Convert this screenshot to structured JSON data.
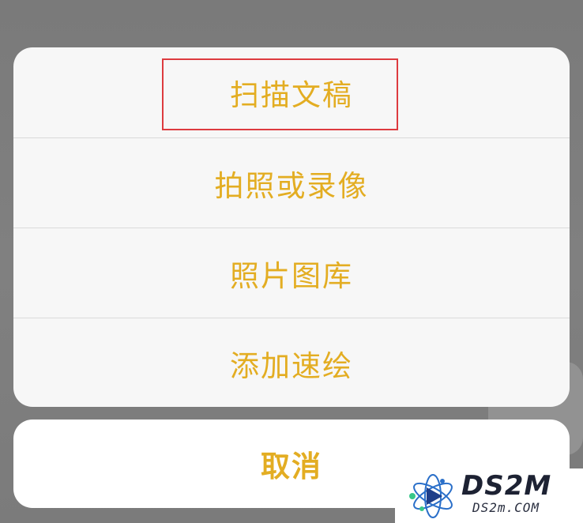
{
  "action_sheet": {
    "items": [
      {
        "label": "扫描文稿",
        "highlighted": true
      },
      {
        "label": "拍照或录像"
      },
      {
        "label": "照片图库"
      },
      {
        "label": "添加速绘"
      }
    ],
    "cancel_label": "取消"
  },
  "watermark": {
    "brand": "DS2M",
    "url": "DS2m.COM"
  },
  "colors": {
    "accent_text": "#e3ad22",
    "highlight_border": "#dd3b3f",
    "sheet_background": "#f7f7f7",
    "dimmed_backdrop": "#7d7d7d"
  }
}
